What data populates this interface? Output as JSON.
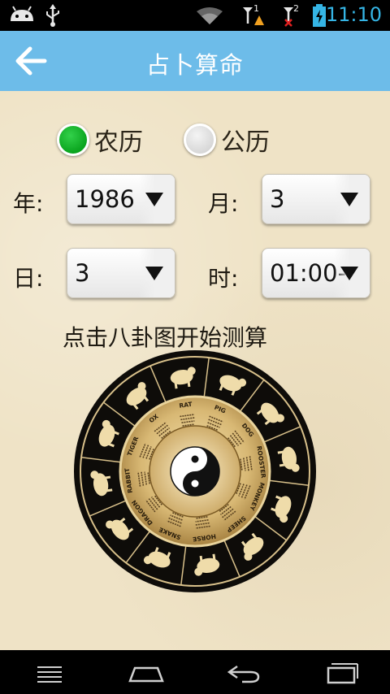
{
  "status_bar": {
    "time": "11:10",
    "icons": [
      "android-icon",
      "usb-icon",
      "wifi-icon",
      "signal-1-icon",
      "signal-2-icon",
      "battery-charging-icon"
    ],
    "signal_labels": [
      "1",
      "2"
    ],
    "accent": "#35b5e5"
  },
  "app_bar": {
    "title": "占卜算命",
    "back_icon": "back-arrow-icon",
    "color": "#6dbce9"
  },
  "calendar": {
    "lunar_label": "农历",
    "solar_label": "公历",
    "selected": "lunar"
  },
  "fields": {
    "year": {
      "label": "年:",
      "value": "1986"
    },
    "month": {
      "label": "月:",
      "value": "3"
    },
    "day": {
      "label": "日:",
      "value": "3"
    },
    "hour": {
      "label": "时:",
      "value": "01:00-"
    }
  },
  "hint": "点击八卦图开始测算",
  "wheel": {
    "animals": [
      "RAT",
      "PIG",
      "DOG",
      "ROOSTER",
      "MONKEY",
      "SHEEP",
      "HORSE",
      "SNAKE",
      "DRAGON",
      "RABBIT",
      "TIGER",
      "OX"
    ]
  },
  "nav_bar": {
    "items": [
      "menu-icon",
      "home-icon",
      "back-icon",
      "recent-apps-icon"
    ]
  }
}
